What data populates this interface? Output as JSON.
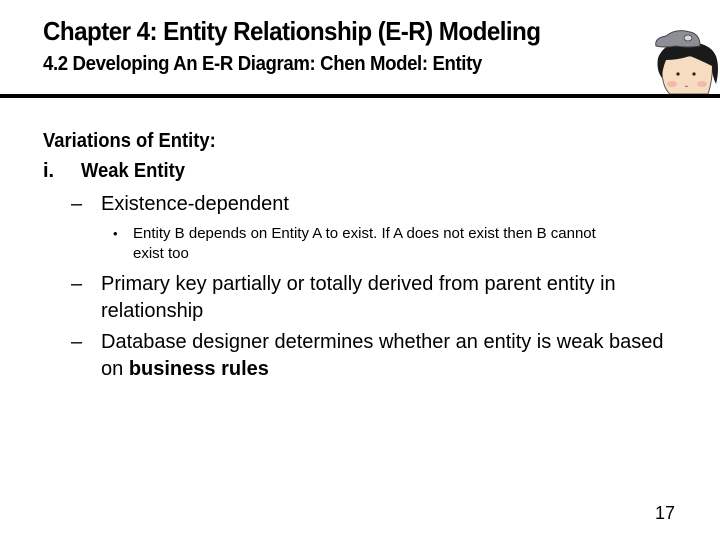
{
  "slide": {
    "title": "Chapter 4: Entity Relationship (E-R) Modeling",
    "subtitle": "4.2 Developing An E-R Diagram: Chen Model: Entity",
    "mascot_icon": "cartoon-character-with-cap",
    "page_number": "17"
  },
  "content": {
    "heading": "Variations of Entity:",
    "item_number": "i.",
    "item_label": "Weak Entity",
    "points": [
      {
        "marker": "–",
        "text": "Existence-dependent",
        "subpoints": [
          {
            "marker": "•",
            "line1": "Entity B depends on Entity A to exist. If A does not exist then B cannot",
            "line2": "exist too"
          }
        ]
      },
      {
        "marker": "–",
        "line1": "Primary key partially or totally derived from parent entity in",
        "line2": "relationship"
      },
      {
        "marker": "–",
        "line1": "Database designer determines whether an entity is weak based",
        "line2_prefix": "on ",
        "line2_bold": "business rules"
      }
    ]
  }
}
